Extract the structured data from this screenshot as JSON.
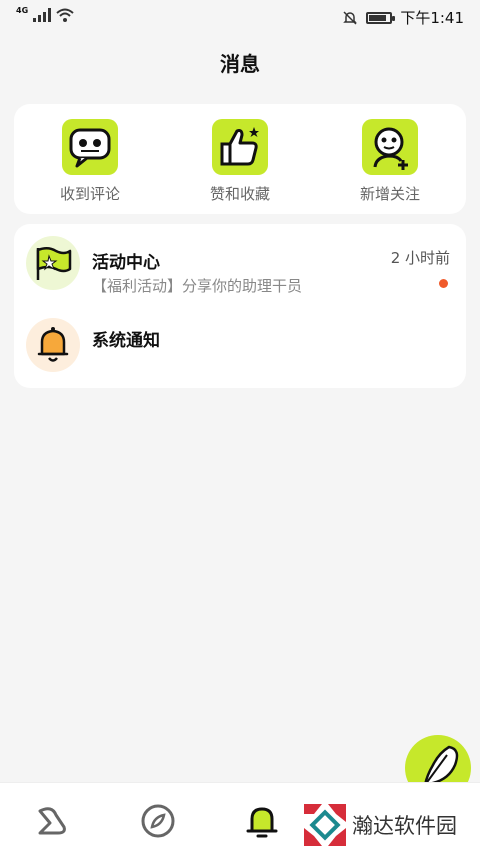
{
  "status_bar": {
    "network": "4G",
    "time": "下午1:41",
    "battery_level": 0.85
  },
  "page": {
    "title": "消息"
  },
  "quick_actions": [
    {
      "label": "收到评论",
      "icon": "comment-robot-icon"
    },
    {
      "label": "赞和收藏",
      "icon": "thumbs-up-icon"
    },
    {
      "label": "新增关注",
      "icon": "add-follower-icon"
    }
  ],
  "messages": [
    {
      "title": "活动中心",
      "subtitle": "【福利活动】分享你的助理干员",
      "time": "2 小时前",
      "icon": "flag-icon",
      "unread": true
    },
    {
      "title": "系统通知",
      "subtitle": "",
      "time": "",
      "icon": "bell-icon",
      "unread": false
    }
  ],
  "tabbar": {
    "items": [
      {
        "icon": "home-icon",
        "active": false
      },
      {
        "icon": "compass-icon",
        "active": false
      },
      {
        "icon": "bell-icon",
        "active": true
      }
    ]
  },
  "fab": {
    "icon": "feather-pen-icon"
  },
  "watermark": {
    "text": "瀚达软件园"
  },
  "colors": {
    "accent": "#c6e82b",
    "unread_dot": "#f05a2b",
    "background": "#f5f5f5"
  }
}
